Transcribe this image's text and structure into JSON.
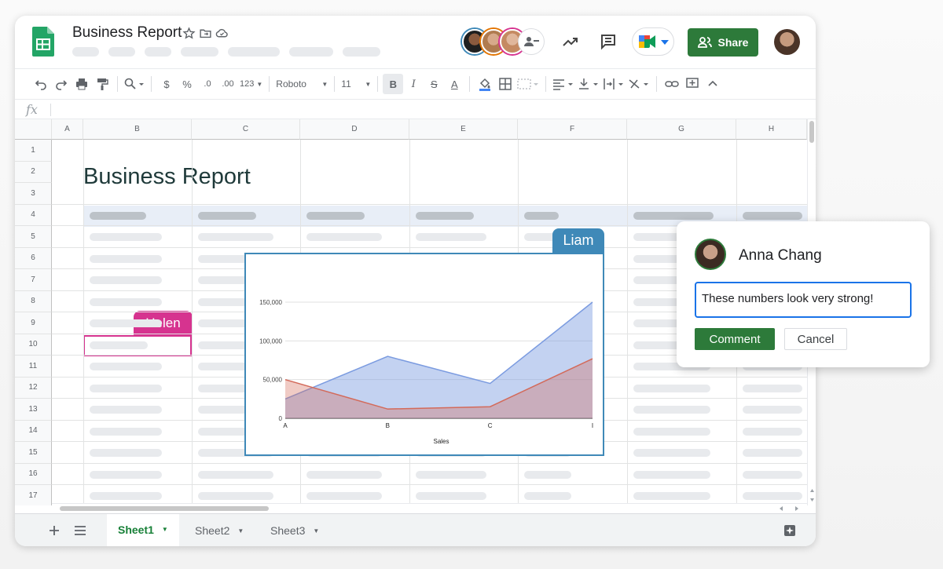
{
  "doc": {
    "title": "Business Report"
  },
  "header": {
    "share_label": "Share"
  },
  "toolbar": {
    "percent": "%",
    "dollar": "$",
    "dec_less": ".0",
    "dec_more": ".00",
    "format_more": "123",
    "font_family": "Roboto",
    "font_size": "11",
    "bold": "B",
    "italic": "I",
    "strike": "S",
    "text_color": "A"
  },
  "formula_bar": {
    "fx": "fx"
  },
  "columns": [
    "A",
    "B",
    "C",
    "D",
    "E",
    "F",
    "G",
    "H"
  ],
  "rows": [
    "1",
    "2",
    "3",
    "4",
    "5",
    "6",
    "7",
    "8",
    "9",
    "10",
    "11",
    "12",
    "13",
    "14",
    "15",
    "16",
    "17"
  ],
  "sheet": {
    "heading": "Business Report"
  },
  "collaborators": {
    "helen": "Helen",
    "liam": "Liam"
  },
  "tabs": [
    {
      "label": "Sheet1"
    },
    {
      "label": "Sheet2"
    },
    {
      "label": "Sheet3"
    }
  ],
  "comment": {
    "author": "Anna Chang",
    "text": "These numbers look very strong!",
    "submit_label": "Comment",
    "cancel_label": "Cancel"
  },
  "chart_data": {
    "type": "area",
    "categories": [
      "A",
      "B",
      "C",
      "D"
    ],
    "x_tick_labels": [
      "A",
      "B",
      "C",
      "I"
    ],
    "series": [
      {
        "values": [
          25000,
          80000,
          45000,
          150000
        ],
        "color": "#7b9be0"
      },
      {
        "values": [
          50000,
          12000,
          15000,
          77000
        ],
        "color": "#d36a5a"
      }
    ],
    "xlabel": "Sales",
    "ylabel": "",
    "ylim": [
      0,
      150000
    ],
    "y_ticks": [
      "0",
      "50,000",
      "100,000",
      "150,000"
    ],
    "grid": true,
    "legend": "none"
  }
}
